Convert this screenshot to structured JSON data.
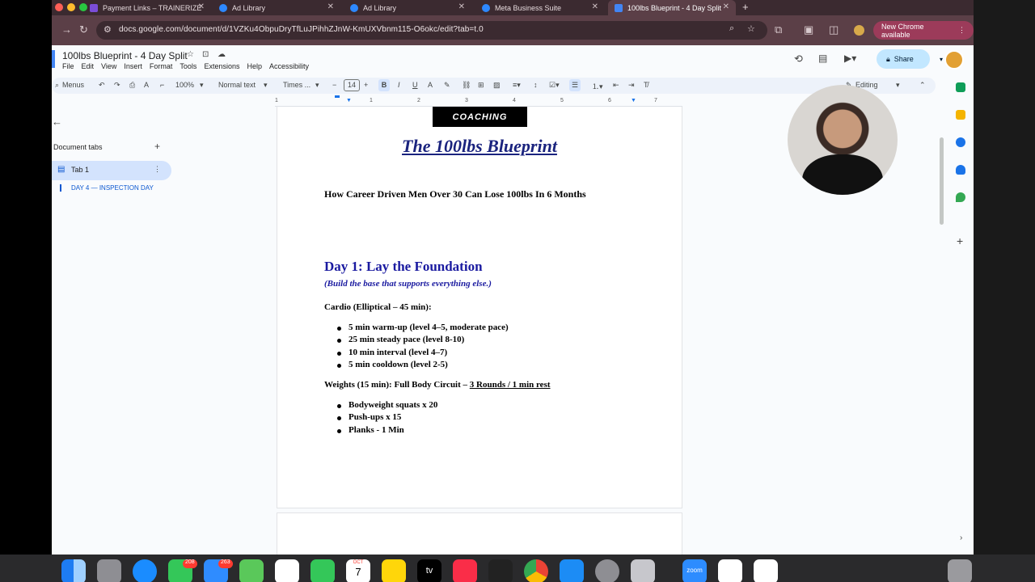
{
  "browser": {
    "tabs": [
      {
        "label": "Payment Links – TRAINERIZE"
      },
      {
        "label": "Ad Library"
      },
      {
        "label": "Ad Library"
      },
      {
        "label": "Meta Business Suite"
      },
      {
        "label": "100lbs Blueprint - 4 Day Split",
        "active": true
      }
    ],
    "url": "docs.google.com/document/d/1VZKu4ObpuDryTfLuJPihhZJnW-KmUXVbnm115-O6okc/edit?tab=t.0",
    "new_chrome_label": "New Chrome available"
  },
  "docs": {
    "title": "100lbs Blueprint - 4 Day Split",
    "menu": [
      "File",
      "Edit",
      "View",
      "Insert",
      "Format",
      "Tools",
      "Extensions",
      "Help",
      "Accessibility"
    ],
    "share_label": "Share",
    "toolbar": {
      "menus_label": "Menus",
      "zoom": "100%",
      "style": "Normal text",
      "font": "Times ...",
      "font_size": "14",
      "editing_label": "Editing"
    },
    "ruler_marks": [
      "1",
      "1",
      "2",
      "3",
      "4",
      "5",
      "6",
      "7"
    ]
  },
  "sidebar": {
    "section_label": "Document tabs",
    "tab_label": "Tab 1",
    "heading_link": "DAY 4 — INSPECTION DAY"
  },
  "document": {
    "logo_text": "COACHING",
    "title": "The 100lbs Blueprint",
    "subtitle": "How Career Driven Men Over 30 Can Lose 100lbs In 6 Months",
    "day_heading": "Day 1: Lay the Foundation",
    "day_subheading": "(Build the base that supports everything else.)",
    "cardio_label": "Cardio (Elliptical – 45 min):",
    "cardio_items": [
      "5 min warm-up (level 4–5, moderate pace)",
      "25 min steady pace (level 8-10)",
      "10 min interval (level 4–7)",
      "5 min cooldown (level 2-5)"
    ],
    "weights_label": "Weights (15 min): Full Body Circuit – ",
    "weights_rounds": "3 Rounds / 1 min rest",
    "weights_items": [
      "Bodyweight squats x 20",
      "Push-ups x 15",
      "Planks - 1 Min"
    ]
  },
  "dock": {
    "badges": [
      "208",
      "263"
    ],
    "calendar_month": "OCT",
    "calendar_day": "7",
    "zoom_label": "zoom",
    "tv_label": "tv"
  },
  "colors": {
    "tab_bar": "#3b2a30",
    "omnibar": "#5b3f47",
    "doc_title_blue": "#1a237e",
    "heading_blue": "#1a1aa0",
    "share_button": "#c2e7ff"
  }
}
